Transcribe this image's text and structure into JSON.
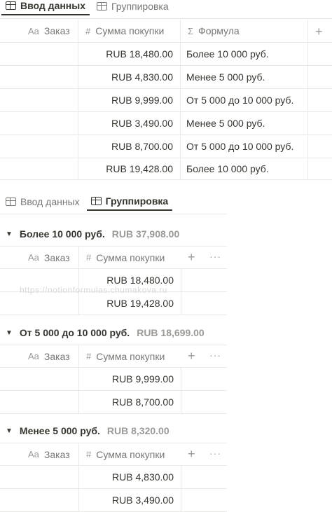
{
  "tabs": {
    "input": "Ввод данных",
    "group": "Группировка"
  },
  "columns": {
    "order": "Заказ",
    "sum": "Сумма покупки",
    "formula": "Формула"
  },
  "icons": {
    "text": "Aa",
    "number": "#",
    "formula": "Σ",
    "plus": "+",
    "more": "···"
  },
  "rows": [
    {
      "sum": "RUB 18,480.00",
      "formula": "Более 10 000 руб."
    },
    {
      "sum": "RUB 4,830.00",
      "formula": "Менее 5 000 руб."
    },
    {
      "sum": "RUB 9,999.00",
      "formula": "От 5 000 до 10 000 руб."
    },
    {
      "sum": "RUB 3,490.00",
      "formula": "Менее 5 000 руб."
    },
    {
      "sum": "RUB 8,700.00",
      "formula": "От 5 000 до 10 000 руб."
    },
    {
      "sum": "RUB 19,428.00",
      "formula": "Более 10 000 руб."
    }
  ],
  "groups": [
    {
      "title": "Более 10 000 руб.",
      "total": "RUB 37,908.00",
      "rows": [
        "RUB 18,480.00",
        "RUB 19,428.00"
      ]
    },
    {
      "title": "От 5 000 до 10 000 руб.",
      "total": "RUB 18,699.00",
      "rows": [
        "RUB 9,999.00",
        "RUB 8,700.00"
      ]
    },
    {
      "title": "Менее 5 000 руб.",
      "total": "RUB 8,320.00",
      "rows": [
        "RUB 4,830.00",
        "RUB 3,490.00"
      ]
    }
  ],
  "watermark": "https://notionformulas.chumakova.ru"
}
